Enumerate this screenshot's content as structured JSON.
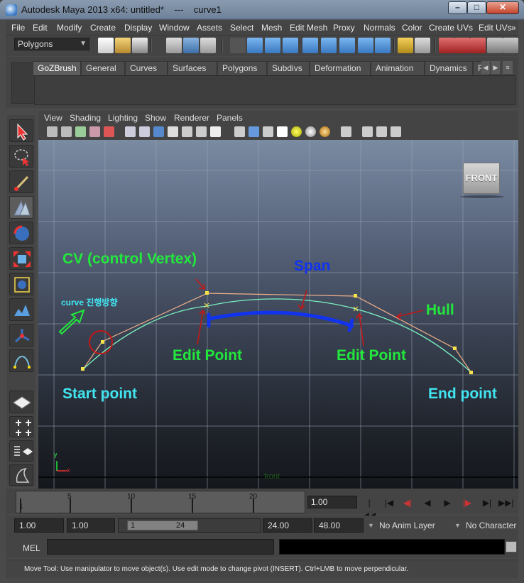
{
  "window": {
    "title": "Autodesk Maya 2013 x64: untitled*    ---    curve1",
    "controls": {
      "minimize": "–",
      "maximize": "□",
      "close": "✕"
    }
  },
  "menubar": [
    "File",
    "Edit",
    "Modify",
    "Create",
    "Display",
    "Window",
    "Assets",
    "Select",
    "Mesh",
    "Edit Mesh",
    "Proxy",
    "Normals",
    "Color",
    "Create UVs",
    "Edit UVs",
    "»"
  ],
  "statusline": {
    "mode": "Polygons"
  },
  "shelf": {
    "tabs": [
      "GoZBrush",
      "General",
      "Curves",
      "Surfaces",
      "Polygons",
      "Subdivs",
      "Deformation",
      "Animation",
      "Dynamics",
      "Re"
    ],
    "active_tab": "GoZBrush"
  },
  "panel": {
    "menus": [
      "View",
      "Shading",
      "Lighting",
      "Show",
      "Renderer",
      "Panels"
    ],
    "camera_label": "front",
    "viewcube_label": "FRONT"
  },
  "annotations": {
    "cv": "CV (control  Vertex)",
    "span": "Span",
    "hull": "Hull",
    "direction": "curve 진행방향",
    "edit_point_left": "Edit Point",
    "edit_point_right": "Edit Point",
    "start_point": "Start point",
    "end_point": "End point",
    "axis_x": "x",
    "axis_y": "y"
  },
  "colors": {
    "annotation_green": "#22e83c",
    "annotation_blue": "#1133ee",
    "annotation_cyan": "#41e5f0",
    "arrow_red": "#c01818",
    "curve_line": "#7bf2bf",
    "hull_line": "#f0b089"
  },
  "timeslider": {
    "ticks": [
      "1",
      "5",
      "10",
      "15",
      "20"
    ],
    "current_time": "1.00"
  },
  "playback": [
    "|◀◀",
    "|◀",
    "◀|",
    "◀",
    "▶",
    "|▶",
    "▶|",
    "▶▶|"
  ],
  "rangeslider": {
    "anim_start": "1.00",
    "playback_start": "1.00",
    "range_start": "1",
    "range_end": "24",
    "playback_end": "24.00",
    "anim_end": "48.00",
    "anim_layer": "No Anim Layer",
    "character_set": "No Character S"
  },
  "cmdline": {
    "label": "MEL"
  },
  "helpline": {
    "text": "Move Tool: Use manipulator to move object(s). Use edit mode to change pivot (INSERT).  Ctrl+LMB to move perpendicular."
  }
}
